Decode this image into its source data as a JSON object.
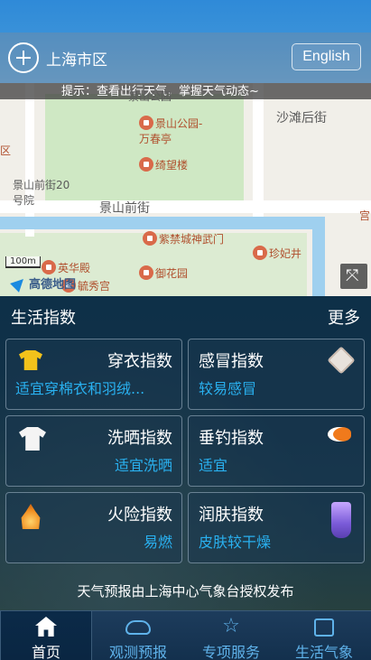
{
  "header": {
    "city": "上海市区",
    "language_button": "English"
  },
  "map": {
    "tip": "提示：查看出行天气，掌握天气动态~",
    "labels": [
      "景山公园",
      "沙滩后街",
      "景山前街",
      "景山前街20号院",
      "区",
      "宫"
    ],
    "pois": [
      "景山公园-万春亭",
      "绮望楼",
      "紫禁城神武门",
      "珍妃井",
      "英华殿",
      "御花园",
      "毓秀宫"
    ],
    "scale": "100m",
    "brand": "高德地图"
  },
  "life_index": {
    "title": "生活指数",
    "more": "更多",
    "cards": [
      {
        "name": "穿衣指数",
        "value": "适宜穿棉衣和羽绒...",
        "icon": "shirt-icon"
      },
      {
        "name": "感冒指数",
        "value": "较易感冒",
        "icon": "dice-icon"
      },
      {
        "name": "洗晒指数",
        "value": "适宜洗晒",
        "icon": "tshirt-icon"
      },
      {
        "name": "垂钓指数",
        "value": "适宜",
        "icon": "fish-icon"
      },
      {
        "name": "火险指数",
        "value": "易燃",
        "icon": "fire-icon"
      },
      {
        "name": "润肤指数",
        "value": "皮肤较干燥",
        "icon": "potion-icon"
      }
    ],
    "footer": "天气预报由上海中心气象台授权发布"
  },
  "tabs": [
    {
      "label": "首页",
      "icon": "home-icon",
      "active": true
    },
    {
      "label": "观测预报",
      "icon": "cloud-icon",
      "active": false
    },
    {
      "label": "专项服务",
      "icon": "star-icon",
      "active": false
    },
    {
      "label": "生活气象",
      "icon": "bag-icon",
      "active": false
    }
  ],
  "colors": {
    "accent": "#29b0ef",
    "header": "#3a92d9",
    "panel": "#123248"
  }
}
